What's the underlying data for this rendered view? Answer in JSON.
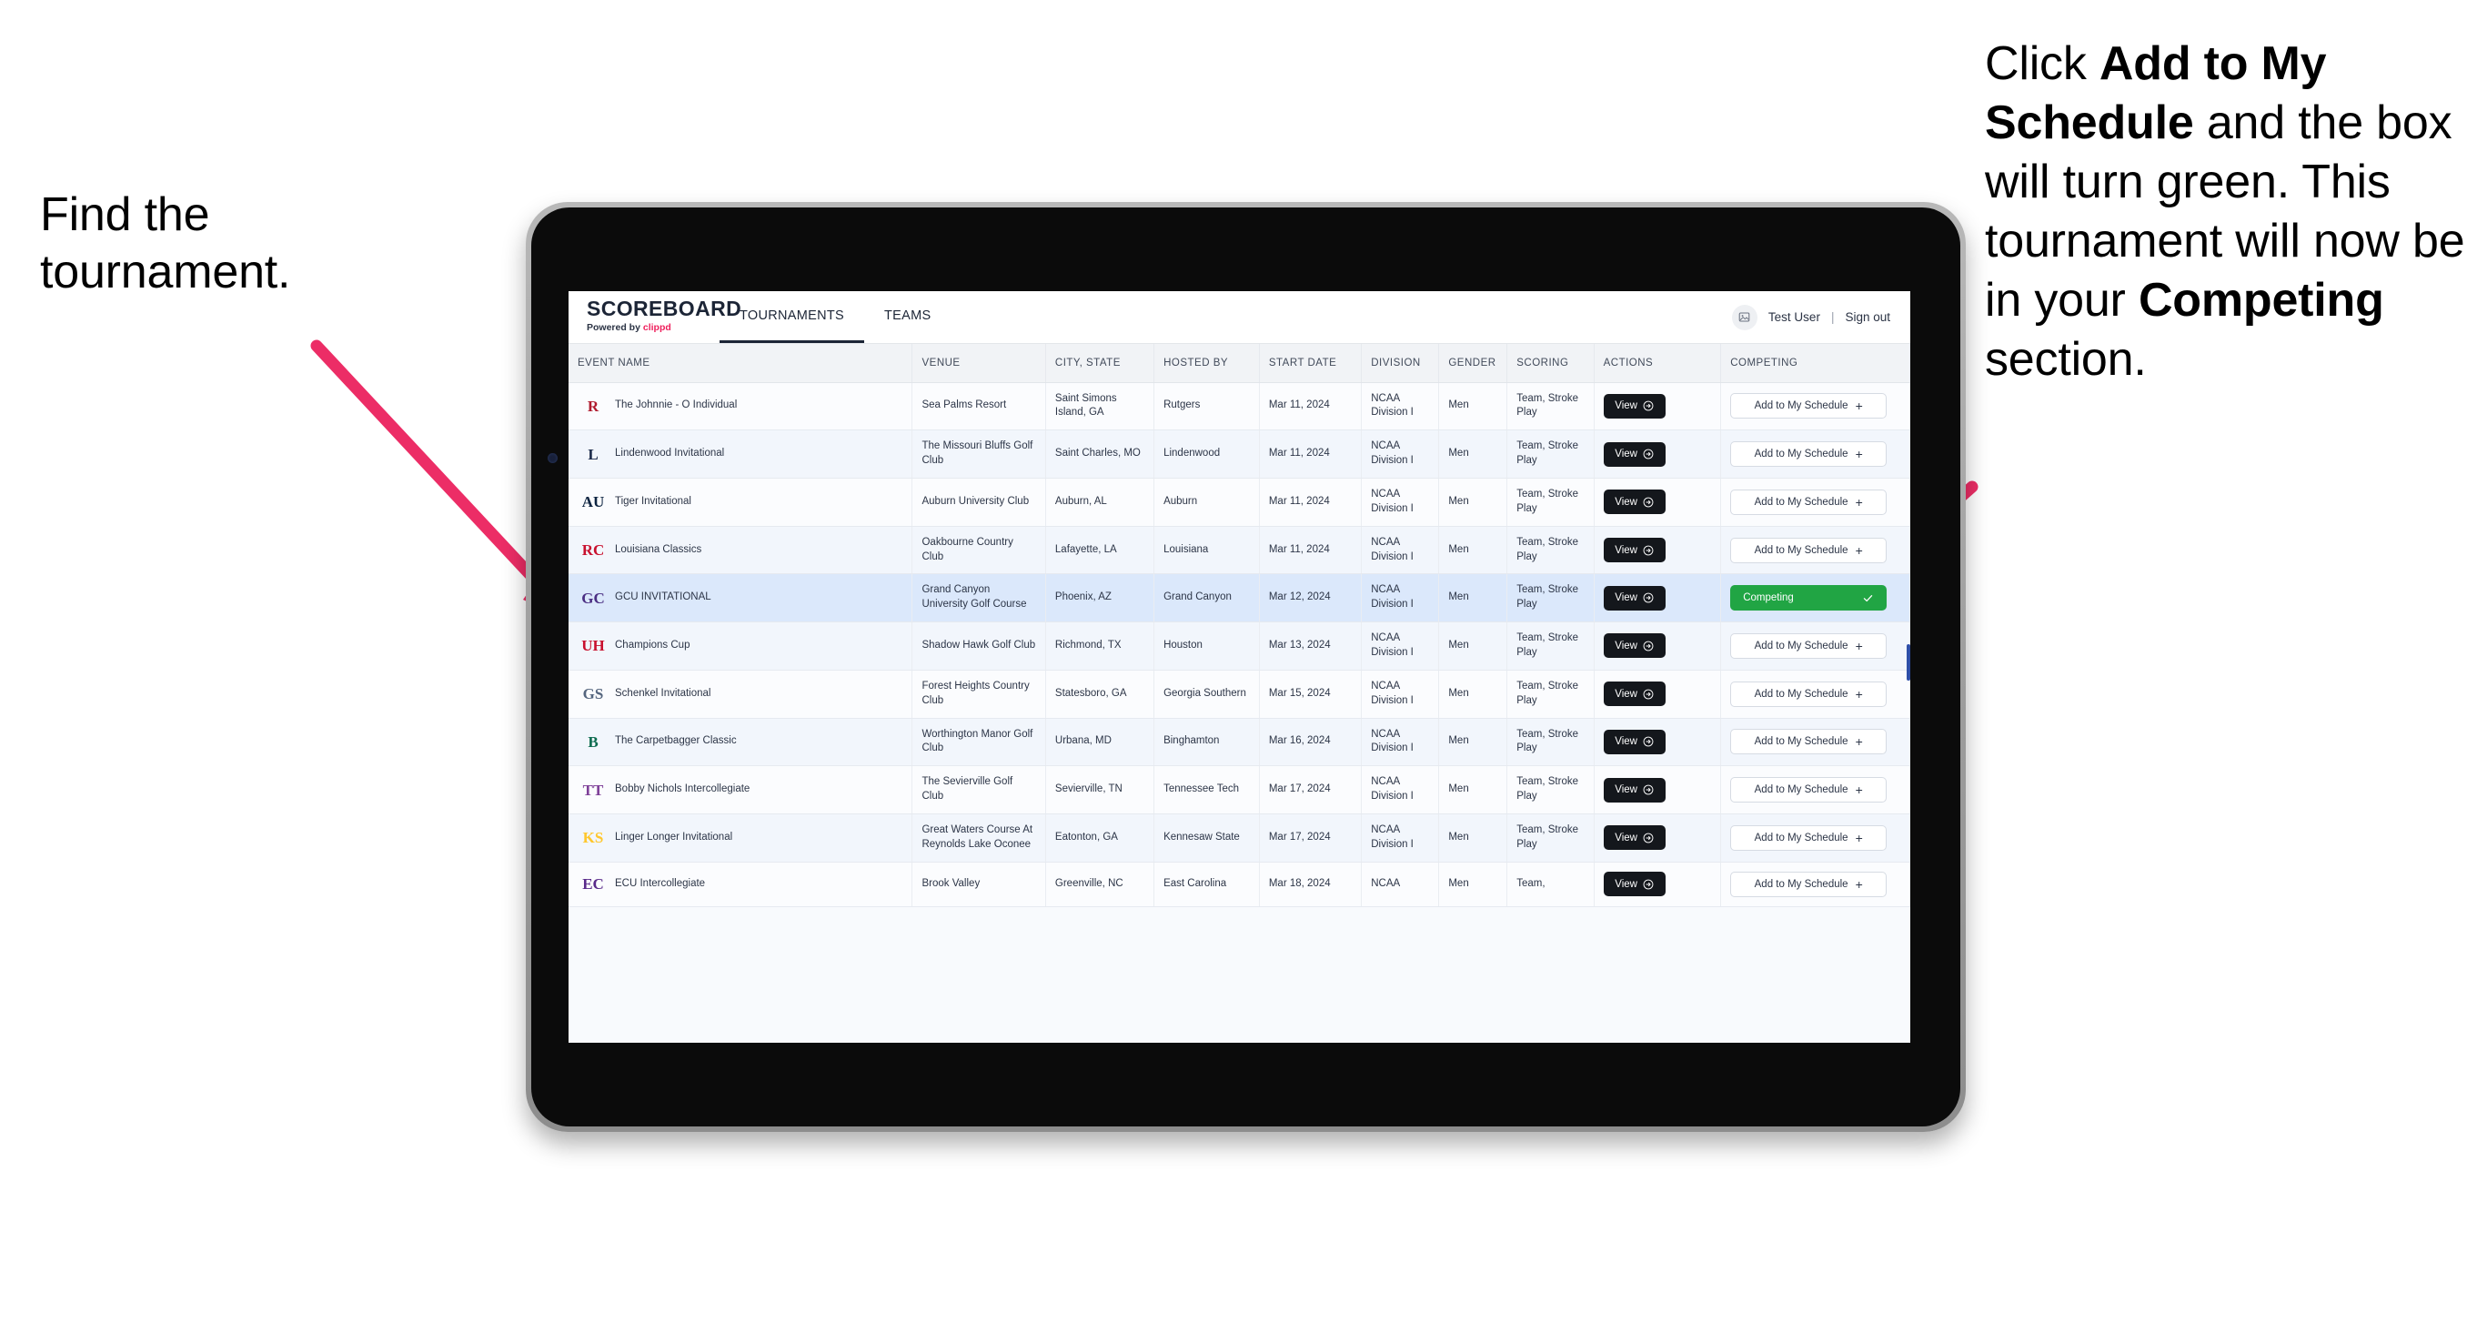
{
  "annotations": {
    "left": "Find the tournament.",
    "right_parts": [
      {
        "text": "Click ",
        "bold": false
      },
      {
        "text": "Add to My Schedule",
        "bold": true
      },
      {
        "text": " and the box will turn green. This tournament will now be in your ",
        "bold": false
      },
      {
        "text": "Competing",
        "bold": true
      },
      {
        "text": " section.",
        "bold": false
      }
    ],
    "arrow_color": "#EC2D66"
  },
  "app": {
    "brand": {
      "title": "SCOREBOARD",
      "powered_prefix": "Powered by ",
      "powered_brand": "clippd"
    },
    "nav": [
      {
        "label": "TOURNAMENTS",
        "active": true
      },
      {
        "label": "TEAMS",
        "active": false
      }
    ],
    "user": {
      "avatar_icon": "user-image-icon",
      "name": "Test User",
      "separator": "|",
      "signout": "Sign out"
    },
    "table": {
      "columns": [
        "EVENT NAME",
        "VENUE",
        "CITY, STATE",
        "HOSTED BY",
        "START DATE",
        "DIVISION",
        "GENDER",
        "SCORING",
        "ACTIONS",
        "COMPETING"
      ],
      "view_label": "View",
      "add_label": "Add to My Schedule",
      "competing_label": "Competing",
      "rows": [
        {
          "logo": "R",
          "logo_color": "#b01b2e",
          "event": "The Johnnie - O Individual",
          "venue": "Sea Palms Resort",
          "city": "Saint Simons Island, GA",
          "host": "Rutgers",
          "date": "Mar 11, 2024",
          "division": "NCAA Division I",
          "gender": "Men",
          "scoring": "Team, Stroke Play",
          "competing": false
        },
        {
          "logo": "L",
          "logo_color": "#1b2a4a",
          "event": "Lindenwood Invitational",
          "venue": "The Missouri Bluffs Golf Club",
          "city": "Saint Charles, MO",
          "host": "Lindenwood",
          "date": "Mar 11, 2024",
          "division": "NCAA Division I",
          "gender": "Men",
          "scoring": "Team, Stroke Play",
          "competing": false
        },
        {
          "logo": "AU",
          "logo_color": "#0c2340",
          "event": "Tiger Invitational",
          "venue": "Auburn University Club",
          "city": "Auburn, AL",
          "host": "Auburn",
          "date": "Mar 11, 2024",
          "division": "NCAA Division I",
          "gender": "Men",
          "scoring": "Team, Stroke Play",
          "competing": false
        },
        {
          "logo": "RC",
          "logo_color": "#c8102e",
          "event": "Louisiana Classics",
          "venue": "Oakbourne Country Club",
          "city": "Lafayette, LA",
          "host": "Louisiana",
          "date": "Mar 11, 2024",
          "division": "NCAA Division I",
          "gender": "Men",
          "scoring": "Team, Stroke Play",
          "competing": false
        },
        {
          "logo": "GC",
          "logo_color": "#4b2e83",
          "event": "GCU INVITATIONAL",
          "venue": "Grand Canyon University Golf Course",
          "city": "Phoenix, AZ",
          "host": "Grand Canyon",
          "date": "Mar 12, 2024",
          "division": "NCAA Division I",
          "gender": "Men",
          "scoring": "Team, Stroke Play",
          "competing": true
        },
        {
          "logo": "UH",
          "logo_color": "#c8102e",
          "event": "Champions Cup",
          "venue": "Shadow Hawk Golf Club",
          "city": "Richmond, TX",
          "host": "Houston",
          "date": "Mar 13, 2024",
          "division": "NCAA Division I",
          "gender": "Men",
          "scoring": "Team, Stroke Play",
          "competing": false
        },
        {
          "logo": "GS",
          "logo_color": "#54657e",
          "event": "Schenkel Invitational",
          "venue": "Forest Heights Country Club",
          "city": "Statesboro, GA",
          "host": "Georgia Southern",
          "date": "Mar 15, 2024",
          "division": "NCAA Division I",
          "gender": "Men",
          "scoring": "Team, Stroke Play",
          "competing": false
        },
        {
          "logo": "B",
          "logo_color": "#0d6b4f",
          "event": "The Carpetbagger Classic",
          "venue": "Worthington Manor Golf Club",
          "city": "Urbana, MD",
          "host": "Binghamton",
          "date": "Mar 16, 2024",
          "division": "NCAA Division I",
          "gender": "Men",
          "scoring": "Team, Stroke Play",
          "competing": false
        },
        {
          "logo": "TT",
          "logo_color": "#7d3f98",
          "event": "Bobby Nichols Intercollegiate",
          "venue": "The Sevierville Golf Club",
          "city": "Sevierville, TN",
          "host": "Tennessee Tech",
          "date": "Mar 17, 2024",
          "division": "NCAA Division I",
          "gender": "Men",
          "scoring": "Team, Stroke Play",
          "competing": false
        },
        {
          "logo": "KS",
          "logo_color": "#ffc72c",
          "event": "Linger Longer Invitational",
          "venue": "Great Waters Course At Reynolds Lake Oconee",
          "city": "Eatonton, GA",
          "host": "Kennesaw State",
          "date": "Mar 17, 2024",
          "division": "NCAA Division I",
          "gender": "Men",
          "scoring": "Team, Stroke Play",
          "competing": false
        },
        {
          "logo": "EC",
          "logo_color": "#592a8a",
          "event": "ECU Intercollegiate",
          "venue": "Brook Valley",
          "city": "Greenville, NC",
          "host": "East Carolina",
          "date": "Mar 18, 2024",
          "division": "NCAA",
          "gender": "Men",
          "scoring": "Team,",
          "competing": false
        }
      ]
    }
  }
}
